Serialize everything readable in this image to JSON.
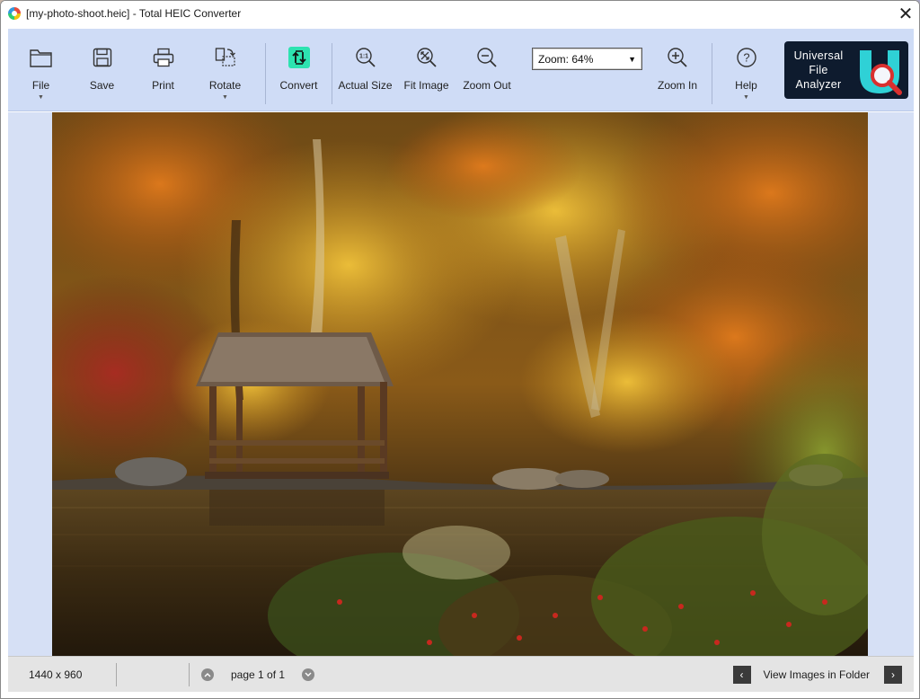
{
  "window": {
    "title": "[my-photo-shoot.heic] - Total HEIC Converter",
    "close_glyph": "✕"
  },
  "toolbar": {
    "file_label": "File",
    "save_label": "Save",
    "print_label": "Print",
    "rotate_label": "Rotate",
    "convert_label": "Convert",
    "actual_size_label": "Actual Size",
    "fit_image_label": "Fit Image",
    "zoom_out_label": "Zoom Out",
    "zoom_select_value": "Zoom: 64%",
    "zoom_in_label": "Zoom In",
    "help_label": "Help",
    "accent_color": "#2de3b0"
  },
  "ad": {
    "line1": "Universal",
    "line2": "File",
    "line3": "Analyzer",
    "logo_letter": "U"
  },
  "image": {
    "description_icon": "photo-autumn-pond-gazebo"
  },
  "status": {
    "dimensions": "1440 x 960",
    "page_text": "page 1 of 1",
    "view_folder_label": "View Images in Folder",
    "prev_glyph": "‹",
    "next_glyph": "›"
  }
}
